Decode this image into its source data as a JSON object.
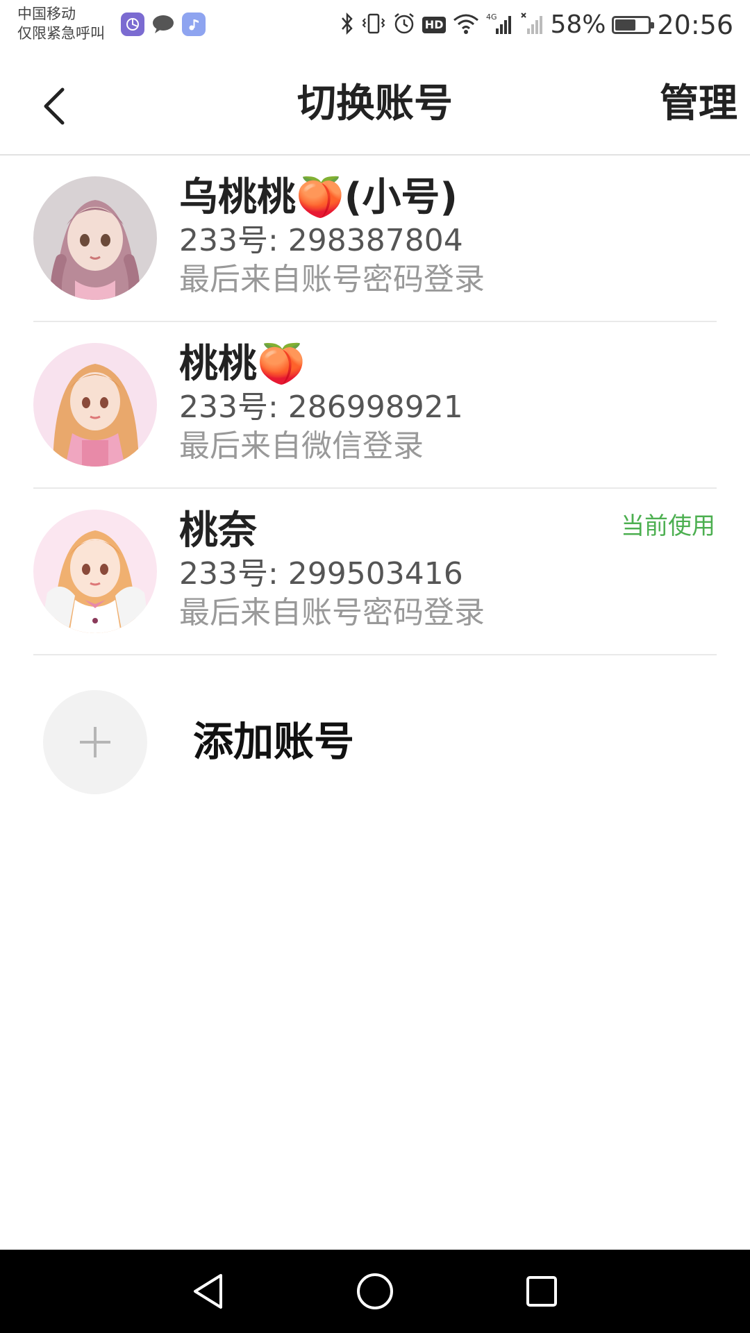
{
  "status_bar": {
    "carrier_line1": "中国移动",
    "carrier_line2": "仅限紧急呼叫",
    "notification_icons": [
      "fan-app-icon",
      "chat-bubble-icon",
      "music-note-icon"
    ],
    "system_icons": [
      "bluetooth-icon",
      "vibrate-icon",
      "alarm-icon",
      "hd-icon",
      "wifi-icon",
      "signal-4g-icon",
      "signal-empty-icon"
    ],
    "hd_label": "HD",
    "battery_percent": "58%",
    "battery_level": 0.58,
    "time": "20:56"
  },
  "header": {
    "title": "切换账号",
    "manage_label": "管理",
    "back_icon": "chevron-left-icon"
  },
  "accounts": [
    {
      "name": "乌桃桃🍑(小号)",
      "id_text": "233号: 298387804",
      "login_text": "最后来自账号密码登录",
      "current": ""
    },
    {
      "name": "桃桃🍑",
      "id_text": "233号: 286998921",
      "login_text": "最后来自微信登录",
      "current": ""
    },
    {
      "name": "桃奈",
      "id_text": "233号: 299503416",
      "login_text": "最后来自账号密码登录",
      "current": "当前使用"
    }
  ],
  "add_account": {
    "label": "添加账号",
    "icon": "plus-icon"
  },
  "nav_bar": {
    "icons": [
      "nav-back-icon",
      "nav-home-icon",
      "nav-recents-icon"
    ]
  },
  "colors": {
    "current_badge": "#4caf50",
    "divider": "#e9e9e9",
    "nav_bg": "#000000"
  }
}
